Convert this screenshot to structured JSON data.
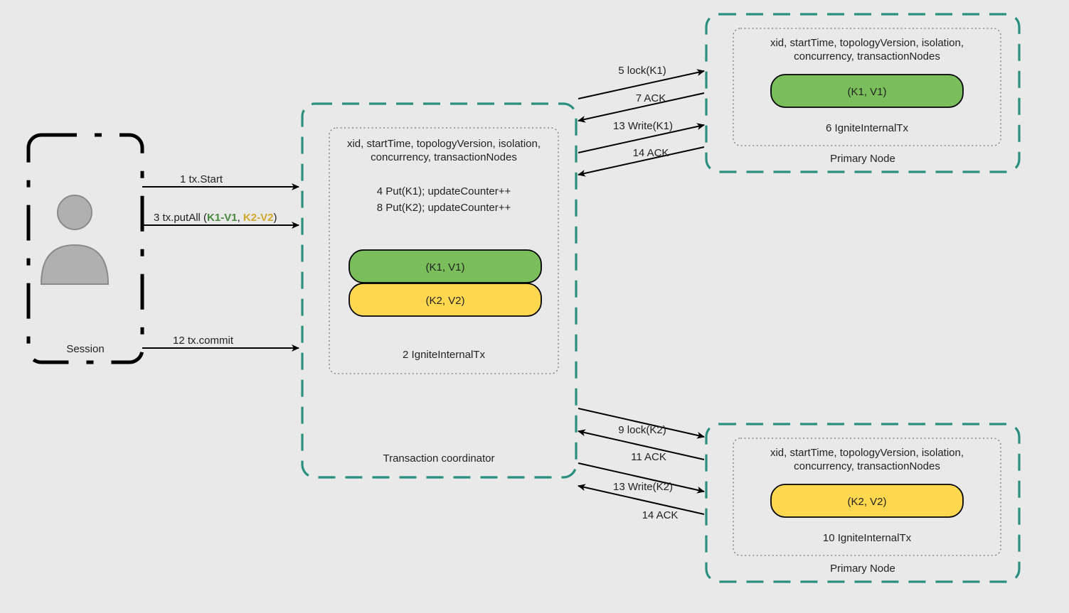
{
  "session": {
    "label": "Session"
  },
  "coordinator": {
    "header": "xid, startTime, topologyVersion, isolation, concurrency, transactionNodes",
    "put1": "4 Put(K1); updateCounter++",
    "put2": "8 Put(K2); updateCounter++",
    "kv1": "(K1, V1)",
    "kv2": "(K2, V2)",
    "internal": "2 IgniteInternalTx",
    "title": "Transaction coordinator"
  },
  "primary1": {
    "header": "xid, startTime, topologyVersion, isolation, concurrency, transactionNodes",
    "kv": "(K1, V1)",
    "internal": "6 IgniteInternalTx",
    "title": "Primary Node"
  },
  "primary2": {
    "header": "xid, startTime, topologyVersion, isolation, concurrency, transactionNodes",
    "kv": "(K2, V2)",
    "internal": "10 IgniteInternalTx",
    "title": "Primary Node"
  },
  "labels": {
    "txStart": "1 tx.Start",
    "txPutAll_pre": "3 tx.putAll (",
    "txPutAll_k1": "K1-V1",
    "txPutAll_sep": ", ",
    "txPutAll_k2": "K2-V2",
    "txPutAll_post": ")",
    "txCommit": "12 tx.commit",
    "lockK1": "5 lock(K1)",
    "ack7": "7 ACK",
    "writeK1": "13 Write(K1)",
    "ack14a": "14 ACK",
    "lockK2": "9 lock(K2)",
    "ack11": "11 ACK",
    "writeK2": "13 Write(K2)",
    "ack14b": "14 ACK"
  }
}
